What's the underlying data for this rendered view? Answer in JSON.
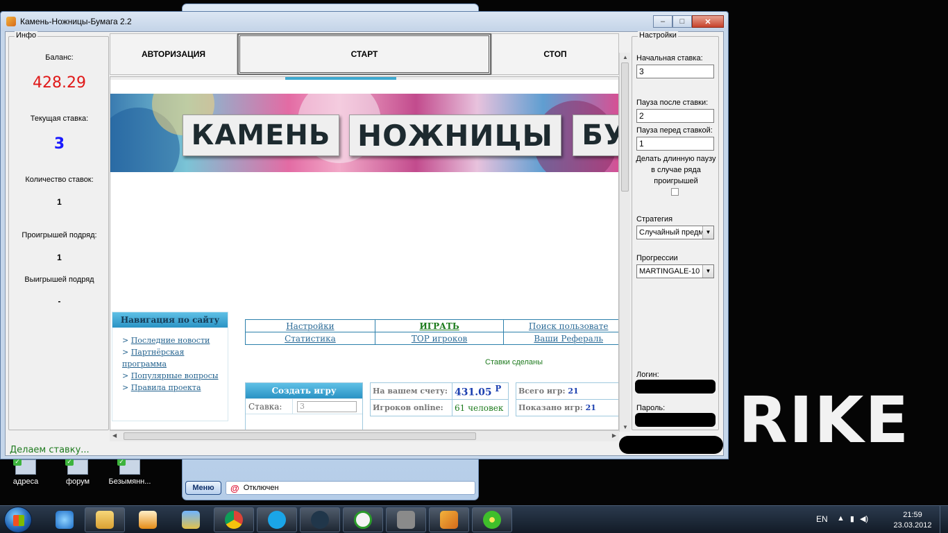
{
  "desktop": {
    "wallpaper_text": "RIKE",
    "icons": [
      {
        "label": "адреса"
      },
      {
        "label": "форум"
      },
      {
        "label": "Безымянн..."
      }
    ]
  },
  "messenger": {
    "menu_label": "Меню",
    "status_text": "Отключен"
  },
  "window": {
    "title": "Камень-Ножницы-Бумага 2.2",
    "minimize": "–",
    "maximize": "□",
    "close": "✕"
  },
  "info": {
    "legend": "Инфо",
    "balance_label": "Баланс:",
    "balance_value": "428.29",
    "bet_label": "Текущая ставка:",
    "bet_value": "3",
    "count_label": "Количество ставок:",
    "count_value": "1",
    "loss_streak_label": "Проигрышей подряд:",
    "loss_streak_value": "1",
    "win_streak_label": "Выигрышей подряд",
    "win_streak_value": "-"
  },
  "toolbar": {
    "auth_label": "АВТОРИЗАЦИЯ",
    "start_label": "СТАРТ",
    "stop_label": "СТОП"
  },
  "site": {
    "banner_words": [
      "КАМЕНЬ",
      "НОЖНИЦЫ",
      "БУ"
    ],
    "nav_title": "Навигация по сайту",
    "nav_items": [
      "Последние новости",
      "Партнёрская программа",
      "Популярные вопросы",
      "Правила проекта"
    ],
    "menu": {
      "settings": "Настройки",
      "play": "ИГРАТЬ",
      "search_user": "Поиск пользовате",
      "statistics": "Статистика",
      "top_players": "TOP игроков",
      "referrals": "Ваши Рефераль"
    },
    "bets_done": "Ставки сделаны",
    "create_game": {
      "title": "Создать игру",
      "bet_label": "Ставка:",
      "bet_placeholder": "3"
    },
    "account": {
      "balance_label": "На вашем счету:",
      "balance_value": "431.05",
      "currency": "Р",
      "online_label": "Игроков online:",
      "online_value": "61 человек"
    },
    "stats": {
      "total_games_label": "Всего игр:",
      "total_games_value": "21",
      "shown_games_label": "Показано игр:",
      "shown_games_value": "21"
    }
  },
  "settings": {
    "legend": "Настройки",
    "initial_bet_label": "Начальная ставка:",
    "initial_bet_value": "3",
    "pause_after_label": "Пауза после ставки:",
    "pause_after_value": "2",
    "pause_before_label": "Пауза перед ставкой:",
    "pause_before_value": "1",
    "long_pause_label": "Делать длинную паузу в случае ряда проигрышей",
    "strategy_label": "Стратегия",
    "strategy_value": "Случайный предм",
    "progression_label": "Прогрессии",
    "progression_value": "MARTINGALE-10",
    "login_label": "Логин:",
    "password_label": "Пароль:"
  },
  "status": {
    "text": "Делаем ставку..."
  },
  "taskbar": {
    "lang": "EN",
    "time": "21:59",
    "date": "23.03.2012"
  },
  "colors": {
    "balance": "#e01818",
    "bet": "#1a1aff",
    "status": "#1e7a1e"
  }
}
